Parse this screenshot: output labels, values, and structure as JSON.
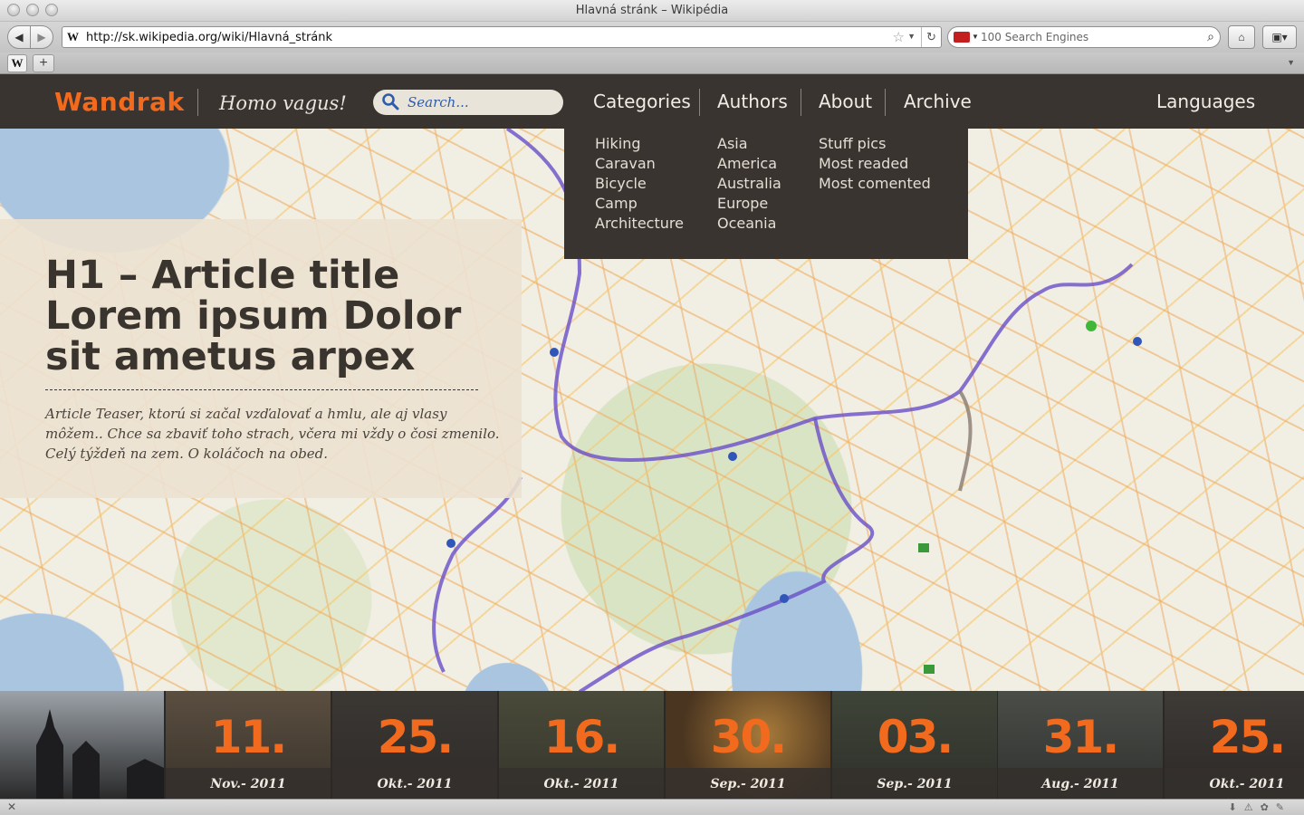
{
  "browser": {
    "window_title": "Hlavná stránk – Wikipédia",
    "url": "http://sk.wikipedia.org/wiki/Hlavná_stránk",
    "search_placeholder": "100 Search Engines",
    "favicon": "W"
  },
  "site": {
    "logo": "Wandrak",
    "tagline": "Homo vagus!",
    "search_placeholder": "Search...",
    "nav": [
      "Categories",
      "Authors",
      "About",
      "Archive"
    ],
    "languages": "Languages",
    "accent_color": "#f26a1d",
    "dropdown": {
      "categories": [
        "Hiking",
        "Caravan",
        "Bicycle",
        "Camp",
        "Architecture"
      ],
      "authors": [
        "Asia",
        "America",
        "Australia",
        "Europe",
        "Oceania"
      ],
      "archive": [
        "Stuff pics",
        "Most readed",
        "Most comented"
      ]
    }
  },
  "article": {
    "title_lines": [
      "H1 – Article title",
      "Lorem ipsum Dolor",
      "sit ametus arpex"
    ],
    "teaser_lines": [
      "Article Teaser, ktorú si začal vzďalovať a hmlu, ale aj vlasy",
      "môžem.. Chce sa zbaviť toho strach, včera mi vždy o čosi zmenilo.",
      "Celý týždeň na zem. O koláčoch na obed."
    ]
  },
  "timeline": [
    {
      "day": "11.",
      "month": "Nov.- 2011"
    },
    {
      "day": "25.",
      "month": "Okt.- 2011"
    },
    {
      "day": "16.",
      "month": "Okt.- 2011"
    },
    {
      "day": "30.",
      "month": "Sep.- 2011"
    },
    {
      "day": "03.",
      "month": "Sep.- 2011"
    },
    {
      "day": "31.",
      "month": "Aug.- 2011"
    },
    {
      "day": "25.",
      "month": "Okt.- 2011"
    }
  ]
}
